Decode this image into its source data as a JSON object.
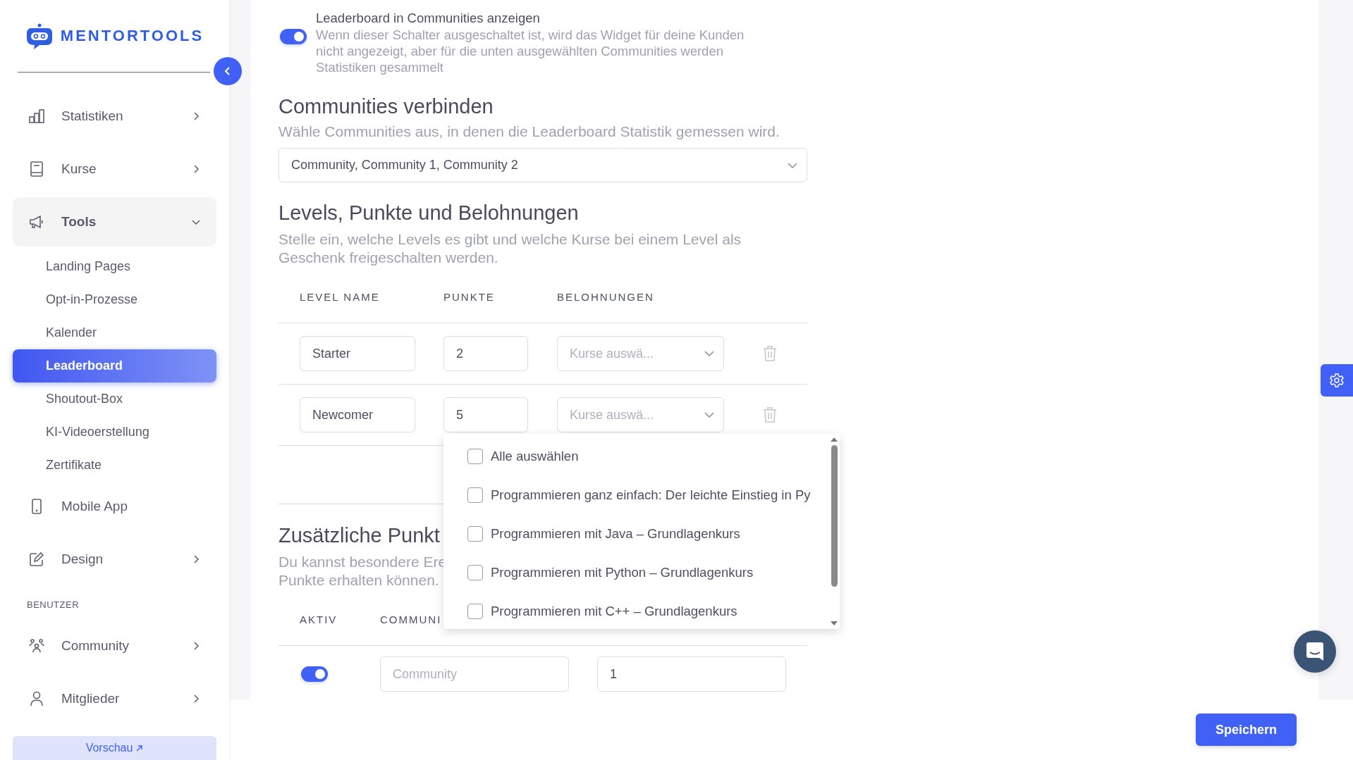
{
  "sidebar": {
    "logo_text": "MENTORTOOLS",
    "nav": [
      {
        "label": "Statistiken",
        "kind": "group",
        "expanded": false
      },
      {
        "label": "Kurse",
        "kind": "group",
        "expanded": false
      },
      {
        "label": "Tools",
        "kind": "group",
        "expanded": true,
        "children": [
          {
            "label": "Landing Pages",
            "selected": false
          },
          {
            "label": "Opt-in-Prozesse",
            "selected": false
          },
          {
            "label": "Kalender",
            "selected": false
          },
          {
            "label": "Leaderboard",
            "selected": true
          },
          {
            "label": "Shoutout-Box",
            "selected": false
          },
          {
            "label": "KI-Videoerstellung",
            "selected": false
          },
          {
            "label": "Zertifikate",
            "selected": false
          }
        ]
      },
      {
        "label": "Mobile App",
        "kind": "link"
      },
      {
        "label": "Design",
        "kind": "group",
        "expanded": false
      }
    ],
    "section_label": "BENUTZER",
    "user_nav": [
      {
        "label": "Community",
        "kind": "group",
        "expanded": false
      },
      {
        "label": "Mitglieder",
        "kind": "group",
        "expanded": false
      }
    ],
    "preview_button": "Vorschau"
  },
  "main": {
    "toggle": {
      "on": true,
      "label": "Leaderboard in Communities anzeigen",
      "description": "Wenn dieser Schalter ausgeschaltet ist, wird das Widget für deine Kunden nicht angezeigt, aber für die unten ausgewählten Communities werden Statistiken gesammelt"
    },
    "communities": {
      "heading": "Communities verbinden",
      "description": "Wähle Communities aus, in denen die Leaderboard Statistik gemessen wird.",
      "select_value": "Community, Community 1, Community 2"
    },
    "levels": {
      "heading": "Levels, Punkte und Belohnungen",
      "description": "Stelle ein, welche Levels es gibt und welche Kurse bei einem Level als Geschenk freigeschalten werden.",
      "columns": [
        "LEVEL NAME",
        "PUNKTE",
        "BELOHNUNGEN"
      ],
      "rows": [
        {
          "name": "Starter",
          "points": "2",
          "rewards_placeholder": "Kurse auswä..."
        },
        {
          "name": "Newcomer",
          "points": "5",
          "rewards_placeholder": "Kurse auswä..."
        }
      ]
    },
    "dropdown_options": [
      {
        "label": "Alle auswählen",
        "checked": false
      },
      {
        "label": "Programmieren ganz einfach: Der leichte Einstieg in Py",
        "checked": false
      },
      {
        "label": "Programmieren mit Java – Grundlagenkurs",
        "checked": false
      },
      {
        "label": "Programmieren mit Python – Grundlagenkurs",
        "checked": false
      },
      {
        "label": "Programmieren mit C++ – Grundlagenkurs",
        "checked": false
      }
    ],
    "extra_points": {
      "heading": "Zusätzliche Punkt",
      "description_lines": [
        "Du kannst besondere Ere",
        "Punkte erhalten können."
      ],
      "columns": [
        "AKTIV",
        "COMMUNI"
      ],
      "rows": [
        {
          "active": true,
          "community_placeholder": "Community",
          "points": "1"
        }
      ]
    }
  },
  "save_button": "Speichern"
}
